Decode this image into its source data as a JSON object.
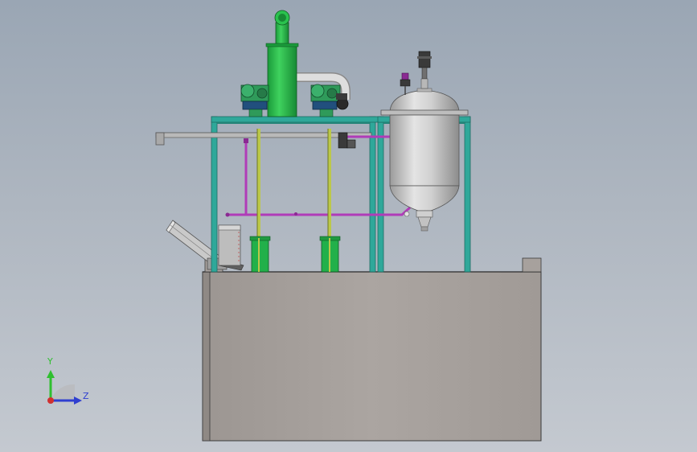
{
  "triad": {
    "x_label": "",
    "y_label": "Y",
    "z_label": "Z"
  },
  "colors": {
    "background_top": "#9aa6b4",
    "background_bottom": "#c4c9d0",
    "tank_body": "#a8a29e",
    "frame": "#2fa89a",
    "column_green": "#22bb44",
    "motor_green": "#2f9a5a",
    "pipe_purple": "#b03cb8",
    "pipe_yellow": "#bcc84a",
    "vessel_steel": "#c8c8c8",
    "axis_y": "#2fbf2f",
    "axis_z": "#2f3fd0",
    "axis_x": "#d03030"
  },
  "components": [
    "base-tank",
    "steel-frame",
    "green-column",
    "gear-motor-left",
    "gear-motor-right",
    "pressure-vessel",
    "screw-conveyor",
    "feed-hopper",
    "pump-left",
    "pump-right"
  ]
}
